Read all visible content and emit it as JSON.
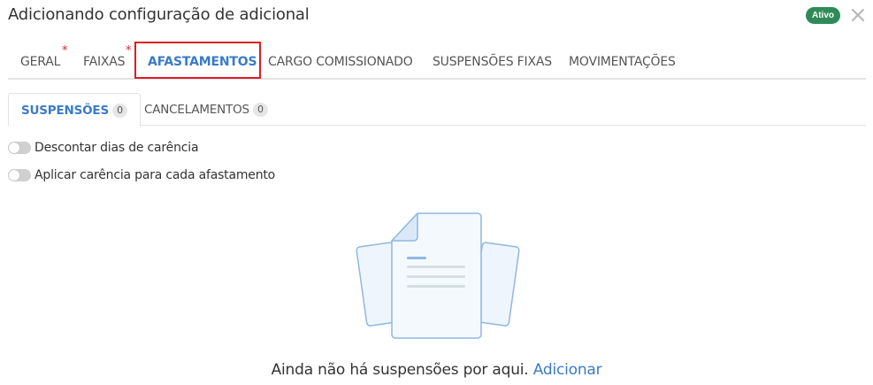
{
  "header": {
    "title": "Adicionando configuração de adicional",
    "status_badge": "Ativo"
  },
  "tabs": [
    {
      "label": "GERAL",
      "required": "*"
    },
    {
      "label": "FAIXAS",
      "required": "*"
    },
    {
      "label": "AFASTAMENTOS",
      "active": true
    },
    {
      "label": "CARGO COMISSIONADO"
    },
    {
      "label": "SUSPENSÕES FIXAS"
    },
    {
      "label": "MOVIMENTAÇÕES"
    }
  ],
  "subtabs": [
    {
      "label": "SUSPENSÕES",
      "count": "0",
      "active": true
    },
    {
      "label": "CANCELAMENTOS",
      "count": "0"
    }
  ],
  "toggles": [
    {
      "label": "Descontar dias de carência",
      "checked": false
    },
    {
      "label": "Aplicar carência para cada afastamento",
      "checked": false
    }
  ],
  "empty_state": {
    "message": "Ainda não há suspensões por aqui.",
    "action": "Adicionar"
  },
  "colors": {
    "accent": "#3a7bc8",
    "badge": "#2e8b57",
    "required": "#d9262b",
    "highlight_box": "#e01b24"
  },
  "icons": {
    "close": "close-icon",
    "empty": "document-stack-icon"
  }
}
